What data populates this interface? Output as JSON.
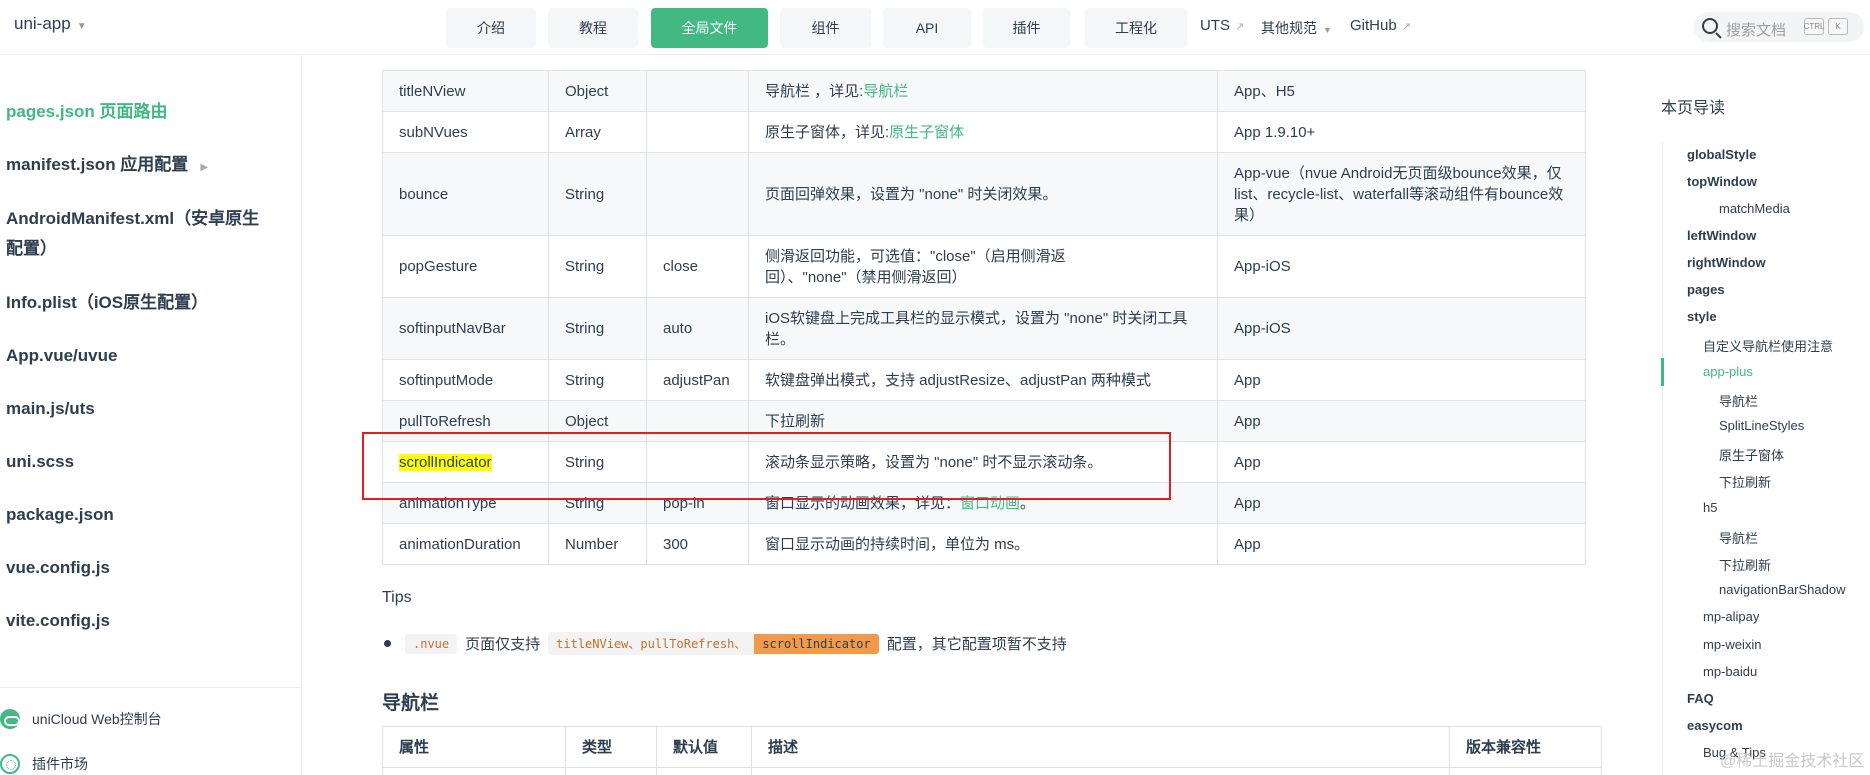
{
  "navbar": {
    "brand": "uni-app",
    "tabs": [
      {
        "label": "介绍"
      },
      {
        "label": "教程"
      },
      {
        "label": "全局文件",
        "active": true
      },
      {
        "label": "组件"
      },
      {
        "label": "API"
      },
      {
        "label": "插件"
      },
      {
        "label": "工程化"
      }
    ],
    "links": {
      "uts": "UTS",
      "other": "其他规范",
      "github": "GitHub"
    },
    "search": {
      "placeholder": "搜索文档",
      "key1": "CTRL",
      "key2": "K"
    }
  },
  "sidebar": {
    "items": [
      {
        "label": "pages.json 页面路由",
        "active": true
      },
      {
        "label": "manifest.json 应用配置"
      },
      {
        "label": "AndroidManifest.xml（安卓原生"
      },
      {
        "label": "配置）"
      },
      {
        "label": "Info.plist（iOS原生配置）"
      },
      {
        "label": "App.vue/uvue"
      },
      {
        "label": "main.js/uts"
      },
      {
        "label": "uni.scss"
      },
      {
        "label": "package.json"
      },
      {
        "label": "vue.config.js"
      },
      {
        "label": "vite.config.js"
      }
    ],
    "links": [
      "uniCloud Web控制台",
      "插件市场"
    ]
  },
  "table": {
    "rows": [
      {
        "prop": "titleNView",
        "type": "Object",
        "default": "",
        "desc": "导航栏 ，详见:",
        "link": "导航栏",
        "compat": "App、H5"
      },
      {
        "prop": "subNVues",
        "type": "Array",
        "default": "",
        "desc": "原生子窗体，详见:",
        "link": "原生子窗体",
        "compat": "App 1.9.10+"
      },
      {
        "prop": "bounce",
        "type": "String",
        "default": "",
        "desc": "页面回弹效果，设置为 \"none\" 时关闭效果。",
        "compat": "App-vue（nvue Android无页面级bounce效果，仅list、recycle-list、waterfall等滚动组件有bounce效果）"
      },
      {
        "prop": "popGesture",
        "type": "String",
        "default": "close",
        "desc": "侧滑返回功能，可选值：\"close\"（启用侧滑返回）、\"none\"（禁用侧滑返回）",
        "compat": "App-iOS"
      },
      {
        "prop": "softinputNavBar",
        "type": "String",
        "default": "auto",
        "desc": "iOS软键盘上完成工具栏的显示模式，设置为 \"none\" 时关闭工具栏。",
        "compat": "App-iOS"
      },
      {
        "prop": "softinputMode",
        "type": "String",
        "default": "adjustPan",
        "desc": "软键盘弹出模式，支持 adjustResize、adjustPan 两种模式",
        "compat": "App"
      },
      {
        "prop": "pullToRefresh",
        "type": "Object",
        "default": "",
        "desc": "下拉刷新",
        "compat": "App"
      },
      {
        "prop": "scrollIndicator",
        "type": "String",
        "default": "",
        "desc": "滚动条显示策略，设置为 \"none\" 时不显示滚动条。",
        "compat": "App"
      },
      {
        "prop": "animationType",
        "type": "String",
        "default": "pop-in",
        "desc": "窗口显示的动画效果，详见：",
        "link": "窗口动画",
        "suffix": "。",
        "compat": "App"
      },
      {
        "prop": "animationDuration",
        "type": "Number",
        "default": "300",
        "desc": "窗口显示动画的持续时间，单位为 ms。",
        "compat": "App"
      }
    ]
  },
  "tips": {
    "title": "Tips",
    "code1": ".nvue",
    "text1": "页面仅支持",
    "code2": "titleNView、pullToRefresh、",
    "code3": "scrollIndicator",
    "text2": "配置，其它配置项暂不支持"
  },
  "section2": {
    "title": "导航栏",
    "headers": [
      "属性",
      "类型",
      "默认值",
      "描述",
      "版本兼容性"
    ]
  },
  "toc": {
    "title": "本页导读",
    "items": [
      {
        "label": "globalStyle",
        "level": 1
      },
      {
        "label": "topWindow",
        "level": 1
      },
      {
        "label": "matchMedia",
        "level": 3
      },
      {
        "label": "leftWindow",
        "level": 1
      },
      {
        "label": "rightWindow",
        "level": 1
      },
      {
        "label": "pages",
        "level": 1
      },
      {
        "label": "style",
        "level": 1
      },
      {
        "label": "自定义导航栏使用注意",
        "level": 2
      },
      {
        "label": "app-plus",
        "level": 2,
        "active": true
      },
      {
        "label": "导航栏",
        "level": 3
      },
      {
        "label": "SplitLineStyles",
        "level": 3
      },
      {
        "label": "原生子窗体",
        "level": 3
      },
      {
        "label": "下拉刷新",
        "level": 3
      },
      {
        "label": "h5",
        "level": 2
      },
      {
        "label": "导航栏",
        "level": 3
      },
      {
        "label": "下拉刷新",
        "level": 3
      },
      {
        "label": "navigationBarShadow",
        "level": 3
      },
      {
        "label": "mp-alipay",
        "level": 2
      },
      {
        "label": "mp-weixin",
        "level": 2
      },
      {
        "label": "mp-baidu",
        "level": 2
      },
      {
        "label": "FAQ",
        "level": 1
      },
      {
        "label": "easycom",
        "level": 1
      },
      {
        "label": "Bug & Tips",
        "level": 2
      }
    ]
  },
  "watermark": "@稀土掘金技术社区",
  "colors": {
    "accent": "#42b983",
    "highlight": "#ffff00",
    "annotation": "#e02020",
    "code_orange": "#f2994a"
  }
}
